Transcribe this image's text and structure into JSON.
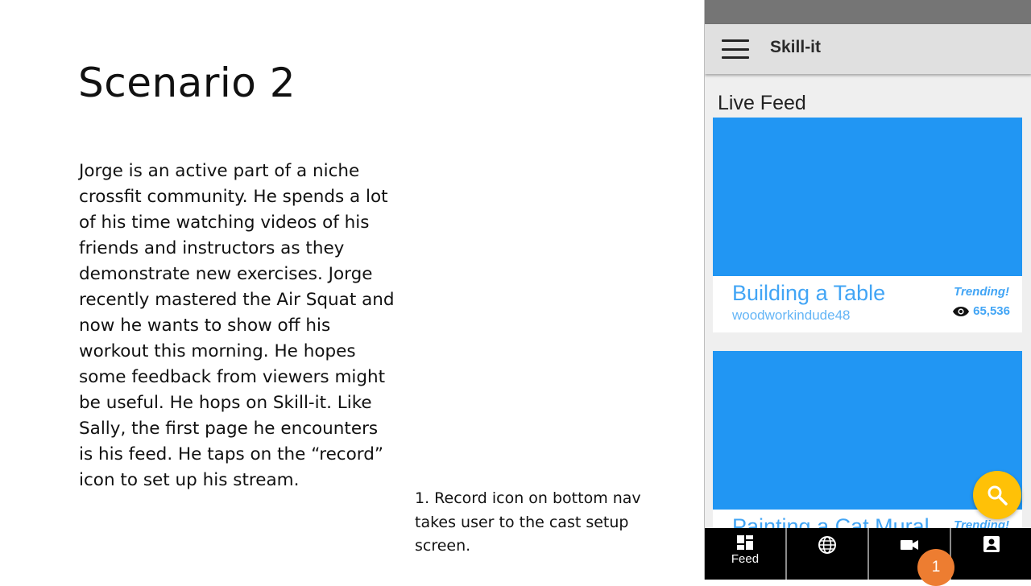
{
  "slide": {
    "title": "Scenario 2",
    "body": "Jorge is an active part of a niche crossfit community. He spends a lot of his time watching videos of his friends and instructors as they demonstrate new exercises. Jorge recently mastered the Air Squat and now he wants to show off his workout this morning. He hopes some feedback from viewers might be useful. He hops on Skill-it. Like Sally, the first page he encounters is his feed. He taps on the “record” icon to set up his stream.",
    "note": "1. Record icon on bottom nav takes user to the cast setup screen."
  },
  "app": {
    "title": "Skill-it",
    "section_title": "Live Feed",
    "cards": [
      {
        "title": "Building a Table",
        "user": "woodworkindude48",
        "badge": "Trending!",
        "views": "65,536"
      },
      {
        "title": "Painting a Cat Mural",
        "badge": "Trending!"
      }
    ],
    "bottom_nav": [
      {
        "label": "Feed",
        "icon": "dashboard-icon"
      },
      {
        "label": "",
        "icon": "globe-icon"
      },
      {
        "label": "",
        "icon": "videocam-icon"
      },
      {
        "label": "",
        "icon": "account-box-icon"
      }
    ],
    "fab_icon": "search-icon",
    "callout_number": "1"
  },
  "colors": {
    "card_image": "#2196f3",
    "accent_text": "#42a5f5",
    "fab": "#ffc107",
    "callout": "#ed7d31",
    "app_bar": "#e0e0e0",
    "status_bar": "#757575"
  }
}
